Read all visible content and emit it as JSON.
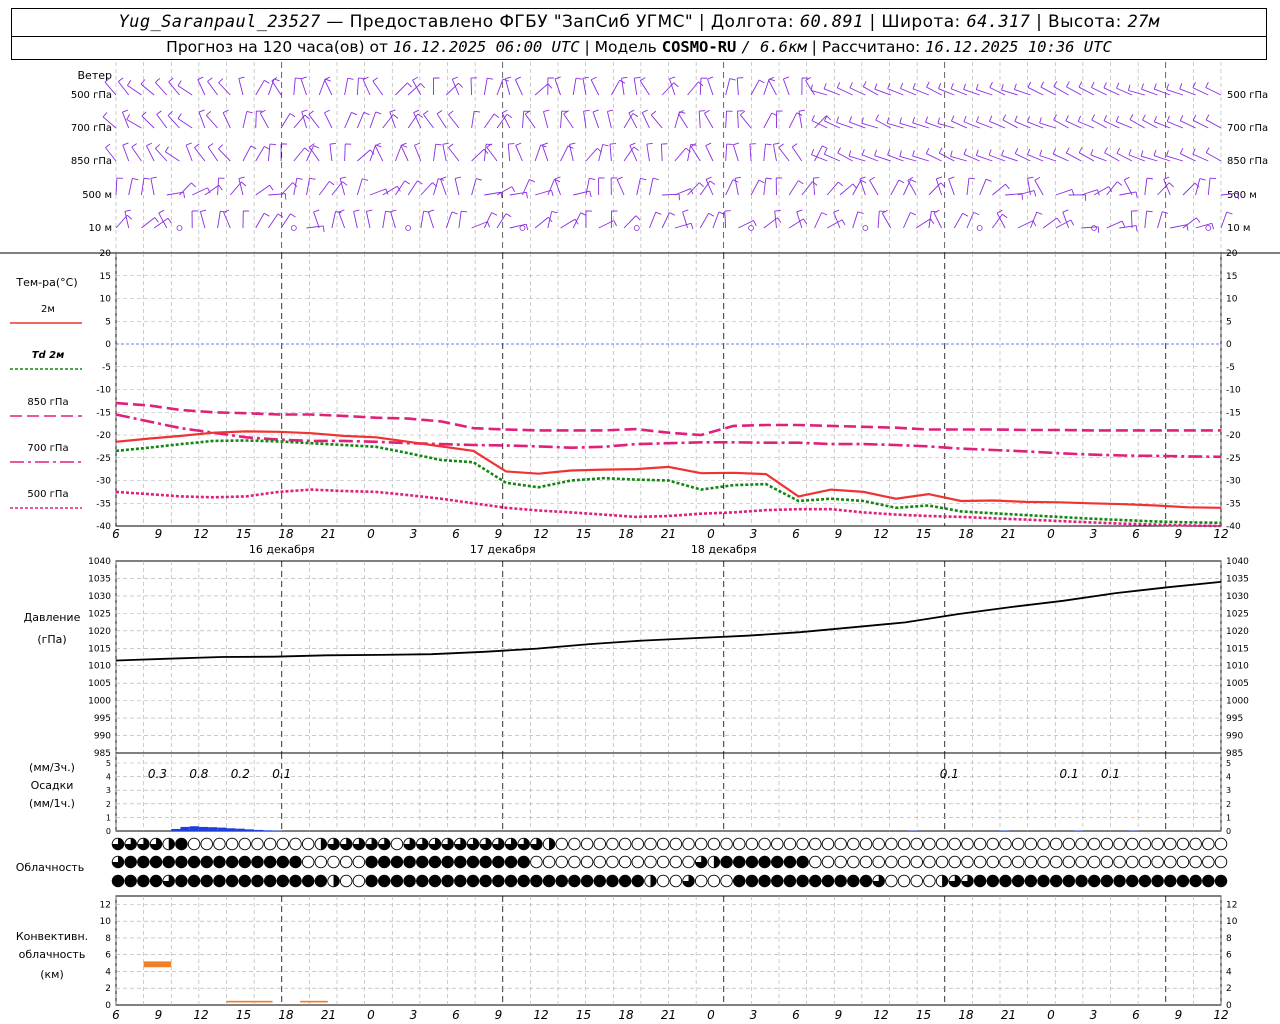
{
  "header": {
    "station": "Yug_Saranpaul_23527",
    "provider": "— Предоставлено ФГБУ \"ЗапСиб УГМС\"",
    "lon_label": "Долгота:",
    "lon_value": "60.891",
    "lat_label": "Широта:",
    "lat_value": "64.317",
    "alt_label": "Высота:",
    "alt_value": "27м",
    "forecast_label": "Прогноз на 120 часа(ов) от",
    "forecast_start": "16.12.2025 06:00 UTC",
    "model_label": "Модель",
    "model_name": "COSMO-RU",
    "model_res": "/ 6.6км",
    "calc_label": "Рассчитано:",
    "calc_time": "16.12.2025 10:36 UTC"
  },
  "time_axis": {
    "tick_labels": [
      "6",
      "9",
      "12",
      "15",
      "18",
      "21",
      "0",
      "3",
      "6",
      "9",
      "12",
      "15",
      "18",
      "21",
      "0",
      "3",
      "6",
      "9",
      "12",
      "15",
      "18",
      "21",
      "0",
      "3",
      "6",
      "9",
      "12"
    ],
    "day_labels": [
      "16 декабря",
      "17 декабря",
      "18 декабря"
    ]
  },
  "wind": {
    "title": "Ветер",
    "levels": [
      "500 гПа",
      "700 гПа",
      "850 гПа",
      "500 м",
      "10 м"
    ],
    "color": "#8a2be2"
  },
  "temperature": {
    "title": "Тем-ра(°С)",
    "legend": [
      {
        "label": "2м",
        "color": "#ee3333",
        "style": "solid"
      },
      {
        "label": "Td  2м",
        "color": "#118811",
        "style": "dotted"
      },
      {
        "label": "850 гПа",
        "color": "#e0207a",
        "style": "dashed"
      },
      {
        "label": "700 гПа",
        "color": "#e0207a",
        "style": "dashdot"
      },
      {
        "label": "500 гПа",
        "color": "#e0207a",
        "style": "dotted"
      }
    ],
    "ticks": [
      "20",
      "15",
      "10",
      "5",
      "0",
      "-5",
      "-10",
      "-15",
      "-20",
      "-25",
      "-30",
      "-35",
      "-40"
    ]
  },
  "pressure": {
    "title": "Давление",
    "unit": "(гПа)",
    "ticks": [
      "1040",
      "1035",
      "1030",
      "1025",
      "1020",
      "1015",
      "1010",
      "1005",
      "1000",
      "995",
      "990",
      "985"
    ]
  },
  "precip": {
    "unit3": "(мм/3ч.)",
    "title": "Осадки",
    "unit1": "(мм/1ч.)",
    "ticks": [
      "5",
      "4",
      "3",
      "2",
      "1",
      "0"
    ],
    "labels": [
      "0.3",
      "0.8",
      "0.2",
      "0.1",
      "0.1",
      "0.1",
      "0.1"
    ]
  },
  "cloud": {
    "title": "Облачность"
  },
  "convective": {
    "title1": "Конвективн.",
    "title2": "облачность",
    "unit": "(км)",
    "ticks": [
      "12",
      "10",
      "8",
      "6",
      "4",
      "2",
      "0"
    ]
  },
  "chart_data": [
    {
      "type": "line",
      "title": "Тем-ра(°С)",
      "x": [
        0,
        3,
        6,
        9,
        12,
        15,
        18,
        21,
        24,
        27,
        30,
        33,
        36,
        39,
        42,
        45,
        48,
        51,
        54,
        57,
        60,
        63,
        66,
        69,
        72,
        75,
        78,
        81,
        84,
        87,
        90,
        93,
        96,
        99,
        102,
        105,
        108,
        111,
        114,
        117,
        120
      ],
      "ylim": [
        -40,
        20
      ],
      "series": [
        {
          "name": "2м",
          "values": [
            -21.5,
            -20.8,
            -20.2,
            -19.5,
            -19.2,
            -19.3,
            -19.6,
            -20.2,
            -20.5,
            -21.5,
            -22.5,
            -23.5,
            -28.0,
            -28.5,
            -27.8,
            -27.6,
            -27.5,
            -27.0,
            -28.4,
            -28.3,
            -28.6,
            -33.5,
            -32.0,
            -32.5,
            -34.0,
            -33.0,
            -34.5,
            -34.4,
            -34.7,
            -34.8,
            -35.0,
            -35.2,
            -35.5,
            -35.9,
            -36.0
          ]
        },
        {
          "name": "Td  2м",
          "values": [
            -23.5,
            -22.8,
            -22.0,
            -21.3,
            -21.2,
            -21.4,
            -21.8,
            -22.2,
            -22.6,
            -24.0,
            -25.5,
            -26.0,
            -30.5,
            -31.5,
            -30.0,
            -29.5,
            -29.8,
            -30.0,
            -32.0,
            -31.0,
            -30.8,
            -34.5,
            -34.0,
            -34.5,
            -36.0,
            -35.5,
            -36.8,
            -37.2,
            -37.6,
            -38.0,
            -38.4,
            -38.7,
            -39.0,
            -39.2,
            -39.3
          ]
        },
        {
          "name": "850 гПа",
          "values": [
            -13.0,
            -13.5,
            -14.5,
            -15.0,
            -15.2,
            -15.5,
            -15.5,
            -15.8,
            -16.2,
            -16.4,
            -17.0,
            -18.5,
            -18.8,
            -19.0,
            -19.0,
            -19.0,
            -18.7,
            -19.5,
            -20.0,
            -18.0,
            -17.8,
            -17.8,
            -18.0,
            -18.2,
            -18.4,
            -18.8,
            -18.8,
            -18.8,
            -18.9,
            -18.9,
            -19.0,
            -19.0,
            -19.0,
            -19.0,
            -19.0
          ]
        },
        {
          "name": "700 гПа",
          "values": [
            -15.5,
            -17.0,
            -18.5,
            -19.5,
            -20.5,
            -21.0,
            -21.3,
            -21.3,
            -21.5,
            -21.8,
            -22.0,
            -22.2,
            -22.3,
            -22.5,
            -22.8,
            -22.6,
            -22.0,
            -21.8,
            -21.6,
            -21.6,
            -21.7,
            -21.7,
            -22.0,
            -22.0,
            -22.2,
            -22.5,
            -23.0,
            -23.3,
            -23.6,
            -24.0,
            -24.3,
            -24.5,
            -24.6,
            -24.7,
            -24.8
          ]
        },
        {
          "name": "500 гПа",
          "values": [
            -32.5,
            -33.0,
            -33.5,
            -33.7,
            -33.5,
            -32.5,
            -32.0,
            -32.3,
            -32.5,
            -33.2,
            -34.0,
            -35.0,
            -36.0,
            -36.6,
            -37.0,
            -37.5,
            -38.0,
            -37.8,
            -37.3,
            -37.0,
            -36.5,
            -36.3,
            -36.3,
            -37.0,
            -37.5,
            -37.8,
            -38.0,
            -38.3,
            -38.6,
            -38.9,
            -39.2,
            -39.5,
            -39.7,
            -39.9,
            -40.0
          ]
        }
      ]
    },
    {
      "type": "line",
      "title": "Давление",
      "ylabel": "(гПа)",
      "x": [
        0,
        6,
        12,
        18,
        24,
        30,
        36,
        42,
        48,
        54,
        60,
        66,
        72,
        78,
        84,
        90,
        96,
        102,
        108,
        114,
        120
      ],
      "ylim": [
        985,
        1040
      ],
      "series": [
        {
          "name": "",
          "values": [
            1011.5,
            1012.0,
            1012.5,
            1012.6,
            1013.0,
            1013.1,
            1013.3,
            1014.0,
            1014.9,
            1016.2,
            1017.2,
            1017.9,
            1018.6,
            1019.6,
            1021.0,
            1022.4,
            1024.8,
            1026.8,
            1028.6,
            1030.8,
            1032.5,
            1034.0
          ]
        }
      ]
    },
    {
      "type": "bar",
      "title": "Осадки",
      "ylabel": "(мм/1ч.)",
      "ylim": [
        0,
        5
      ],
      "x": [
        6,
        7,
        8,
        9,
        10,
        11,
        12,
        13,
        14,
        15,
        16,
        17,
        86,
        96,
        104,
        110
      ],
      "values": [
        0.15,
        0.3,
        0.35,
        0.3,
        0.28,
        0.25,
        0.2,
        0.17,
        0.12,
        0.08,
        0.05,
        0.03,
        0.03,
        0.03,
        0.03,
        0.03
      ]
    },
    {
      "type": "bar",
      "title": "Конвективн. облачность",
      "ylabel": "(км)",
      "ylim": [
        0,
        13
      ],
      "x_ranges": [
        [
          3,
          6
        ],
        [
          12,
          17
        ],
        [
          20,
          23
        ]
      ],
      "bottom": [
        4.5,
        0.3,
        0.3
      ],
      "top": [
        5.2,
        0.5,
        0.5
      ]
    }
  ]
}
